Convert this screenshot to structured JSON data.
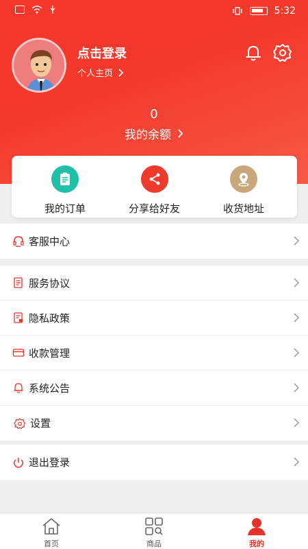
{
  "status_bar": {
    "time": "5:32"
  },
  "profile": {
    "login_title": "点击登录",
    "homepage_link": "个人主页"
  },
  "balance": {
    "value": "0",
    "label": "我的余额"
  },
  "quick_actions": [
    {
      "label": "我的订单",
      "icon": "order-icon",
      "color": "#1fc0a7"
    },
    {
      "label": "分享给好友",
      "icon": "share-icon",
      "color": "#ef3a2b"
    },
    {
      "label": "收货地址",
      "icon": "location-icon",
      "color": "#c9a77a"
    }
  ],
  "menu": {
    "service_center": "客服中心",
    "service_agreement": "服务协议",
    "privacy_policy": "隐私政策",
    "payment_management": "收款管理",
    "system_notice": "系统公告",
    "settings": "设置",
    "logout": "退出登录"
  },
  "tabs": [
    {
      "label": "首页",
      "icon": "home-icon"
    },
    {
      "label": "商品",
      "icon": "products-icon"
    },
    {
      "label": "我的",
      "icon": "user-icon"
    }
  ],
  "colors": {
    "primary": "#f43a2d",
    "accent_red": "#e6332a"
  }
}
